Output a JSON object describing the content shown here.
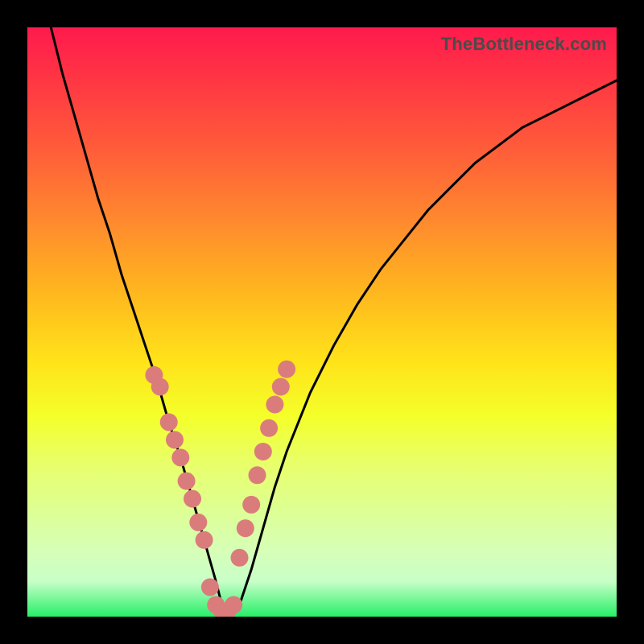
{
  "attribution": "TheBottleneck.com",
  "chart_data": {
    "type": "line",
    "title": "",
    "xlabel": "",
    "ylabel": "",
    "xlim": [
      0,
      100
    ],
    "ylim": [
      0,
      100
    ],
    "series": [
      {
        "name": "bottleneck-curve",
        "x": [
          4,
          6,
          8,
          10,
          12,
          14,
          16,
          18,
          20,
          22,
          24,
          26,
          28,
          30,
          32,
          33,
          34,
          36,
          38,
          40,
          42,
          44,
          48,
          52,
          56,
          60,
          64,
          68,
          72,
          76,
          80,
          84,
          88,
          92,
          96,
          100
        ],
        "y": [
          100,
          92,
          85,
          78,
          71,
          65,
          58,
          52,
          46,
          40,
          33,
          27,
          20,
          13,
          6,
          2,
          0,
          2,
          8,
          15,
          22,
          28,
          38,
          46,
          53,
          59,
          64,
          69,
          73,
          77,
          80,
          83,
          85,
          87,
          89,
          91
        ]
      },
      {
        "name": "sample-points-left",
        "x": [
          21.5,
          22.5,
          24.0,
          25.0,
          26.0,
          27.0,
          28.0,
          29.0,
          30.0
        ],
        "y": [
          41,
          39,
          33,
          30,
          27,
          23,
          20,
          16,
          13
        ]
      },
      {
        "name": "sample-points-bottom",
        "x": [
          31.0,
          32.0,
          33.0,
          34.0,
          35.0
        ],
        "y": [
          5,
          2,
          1,
          1,
          2
        ]
      },
      {
        "name": "sample-points-right",
        "x": [
          36.0,
          37.0,
          38.0,
          39.0,
          40.0,
          41.0,
          42.0,
          43.0,
          44.0
        ],
        "y": [
          10,
          15,
          19,
          24,
          28,
          32,
          36,
          39,
          42
        ]
      }
    ]
  }
}
